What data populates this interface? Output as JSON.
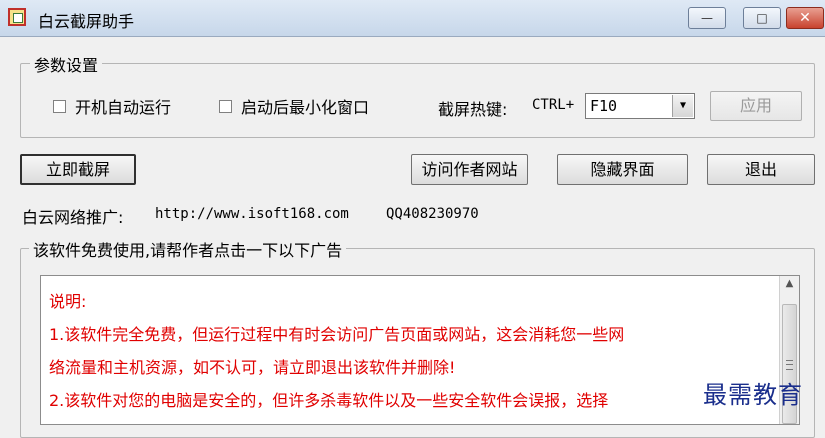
{
  "window": {
    "title": "白云截屏助手",
    "controls": {
      "minimize": "—",
      "maximize": "□",
      "close": "✕"
    }
  },
  "settings": {
    "group_label": "参数设置",
    "autostart_label": "开机自动运行",
    "autostart_checked": false,
    "minimize_label": "启动后最小化窗口",
    "minimize_checked": false,
    "hotkey_label": "截屏热键:",
    "hotkey_prefix": "CTRL+",
    "hotkey_value": "F10",
    "apply_label": "应用"
  },
  "actions": {
    "capture": "立即截屏",
    "visit": "访问作者网站",
    "hide": "隐藏界面",
    "exit": "退出"
  },
  "promo": {
    "label": "白云网络推广:",
    "url": "http://www.isoft168.com",
    "qq": "QQ408230970"
  },
  "ads": {
    "group_label": "该软件免费使用,请帮作者点击一下以下广告",
    "lines": [
      "说明:",
      "1.该软件完全免费，但运行过程中有时会访问广告页面或网站，这会消耗您一些网",
      "络流量和主机资源，如不认可，请立即退出该软件并删除!",
      "2.该软件对您的电脑是安全的，但许多杀毒软件以及一些安全软件会误报，选择"
    ]
  },
  "watermark": "最需教育",
  "colors": {
    "ad_text": "#e00000",
    "watermark": "#1a2e8c"
  }
}
